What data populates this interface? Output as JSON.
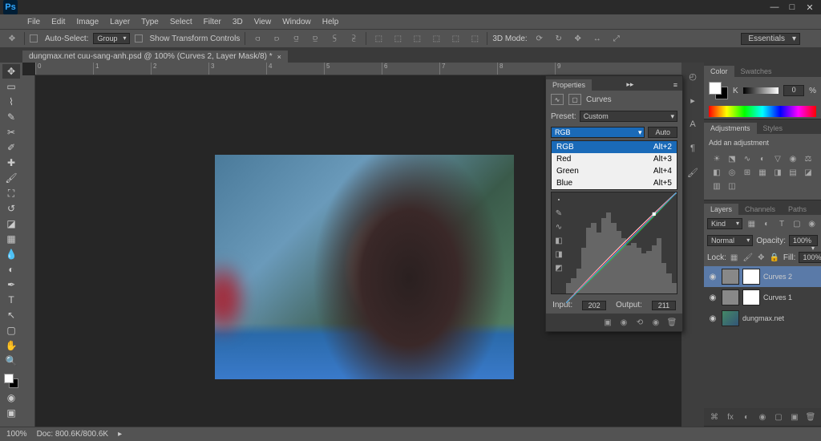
{
  "window_controls": {
    "min": "—",
    "max": "□",
    "close": "✕"
  },
  "menus": [
    "File",
    "Edit",
    "Image",
    "Layer",
    "Type",
    "Select",
    "Filter",
    "3D",
    "View",
    "Window",
    "Help"
  ],
  "options": {
    "auto_select": "Auto-Select:",
    "group": "Group",
    "show_transform": "Show Transform Controls",
    "mode_3d": "3D Mode:"
  },
  "workspace": "Essentials",
  "doc_tab": "dungmax.net cuu-sang-anh.psd @ 100% (Curves 2, Layer Mask/8) *",
  "ruler_marks": [
    "0",
    "1",
    "2",
    "3",
    "4",
    "5",
    "6",
    "7",
    "8",
    "9"
  ],
  "properties": {
    "title": "Properties",
    "adj_name": "Curves",
    "preset_label": "Preset:",
    "preset_value": "Custom",
    "channel": "RGB",
    "auto": "Auto",
    "channels": [
      {
        "name": "RGB",
        "key": "Alt+2"
      },
      {
        "name": "Red",
        "key": "Alt+3"
      },
      {
        "name": "Green",
        "key": "Alt+4"
      },
      {
        "name": "Blue",
        "key": "Alt+5"
      }
    ],
    "input_label": "Input:",
    "input_value": "202",
    "output_label": "Output:",
    "output_value": "211"
  },
  "color": {
    "tab1": "Color",
    "tab2": "Swatches",
    "label": "K",
    "value": "0",
    "pct": "%"
  },
  "adjustments": {
    "tab1": "Adjustments",
    "tab2": "Styles",
    "hint": "Add an adjustment"
  },
  "layers": {
    "tabs": [
      "Layers",
      "Channels",
      "Paths"
    ],
    "kind": "Kind",
    "blend": "Normal",
    "opacity_label": "Opacity:",
    "opacity": "100%",
    "lock_label": "Lock:",
    "fill_label": "Fill:",
    "fill": "100%",
    "items": [
      {
        "name": "Curves 2"
      },
      {
        "name": "Curves 1"
      },
      {
        "name": "dungmax.net"
      }
    ]
  },
  "status": {
    "zoom": "100%",
    "doc": "Doc: 800.6K/800.6K"
  }
}
